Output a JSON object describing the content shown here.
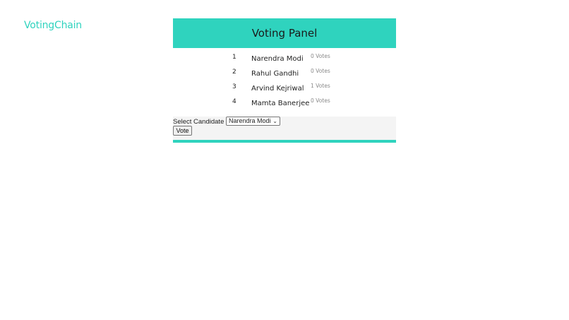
{
  "brand": {
    "name": "VotingChain"
  },
  "panel": {
    "title": "Voting Panel"
  },
  "candidates": [
    {
      "id": "1",
      "name": "Narendra Modi",
      "votes": "0 Votes"
    },
    {
      "id": "2",
      "name": "Rahul Gandhi",
      "votes": "0 Votes"
    },
    {
      "id": "3",
      "name": "Arvind Kejriwal",
      "votes": "1 Votes"
    },
    {
      "id": "4",
      "name": "Mamta Banerjee",
      "votes": "0 Votes"
    }
  ],
  "form": {
    "select_label": "Select Candidate",
    "selected_value": "Narendra Modi",
    "vote_label": "Vote"
  },
  "colors": {
    "accent": "#2fd3be",
    "vote_count": "#8a8a8a",
    "form_bg": "#f4f4f4"
  }
}
